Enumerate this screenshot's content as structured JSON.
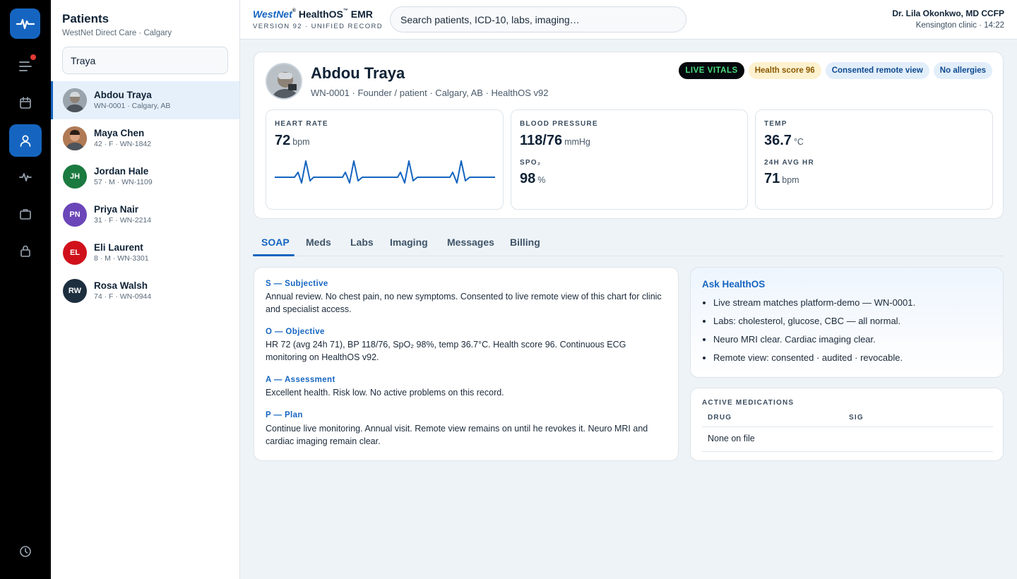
{
  "rail": {
    "items": [
      {
        "icon": "menu-icon",
        "notification": true
      },
      {
        "icon": "calendar-icon"
      },
      {
        "icon": "user-icon",
        "active": true
      },
      {
        "icon": "activity-icon"
      },
      {
        "icon": "briefcase-icon"
      },
      {
        "icon": "lock-icon"
      },
      {
        "icon": "clock-icon"
      }
    ],
    "logo_icon": "pulse-icon",
    "accent": "#1565c0",
    "notification_color": "#e53935"
  },
  "patients": {
    "title": "Patients",
    "subtitle": "WestNet Direct Care · Calgary",
    "search_value": "Traya",
    "list": [
      {
        "name": "Abdou Traya",
        "meta": "WN-0001 · Calgary, AB",
        "initials": "",
        "photo": true,
        "color": "#9aa4ad",
        "selected": true
      },
      {
        "name": "Maya Chen",
        "meta": "42 · F · WN-1842",
        "initials": "",
        "photo": true,
        "color": "#b07a55"
      },
      {
        "name": "Jordan Hale",
        "meta": "57 · M · WN-1109",
        "initials": "JH",
        "color": "#1b7a3f"
      },
      {
        "name": "Priya Nair",
        "meta": "31 · F · WN-2214",
        "initials": "PN",
        "color": "#6b46b8"
      },
      {
        "name": "Eli Laurent",
        "meta": "8 · M · WN-3301",
        "initials": "EL",
        "color": "#d0111b"
      },
      {
        "name": "Rosa Walsh",
        "meta": "74 · F · WN-0944",
        "initials": "RW",
        "color": "#1d2f3f"
      }
    ]
  },
  "header": {
    "brand_west": "WestNet",
    "brand_product": "HealthOS",
    "brand_suffix": "EMR",
    "brand_version": "VERSION 92 · UNIFIED RECORD",
    "search_placeholder": "Search patients, ICD-10, labs, imaging…",
    "doctor": "Dr. Lila Okonkwo, MD CCFP",
    "clinic_time": "Kensington clinic · 14:22"
  },
  "patient": {
    "name": "Abdou Traya",
    "meta": "WN-0001 · Founder / patient · Calgary, AB · HealthOS v92",
    "badges": {
      "live": "LIVE VITALS",
      "score": "Health score 96",
      "consent": "Consented remote view",
      "allergy": "No allergies"
    }
  },
  "vitals": {
    "hr": {
      "label": "HEART RATE",
      "value": "72",
      "unit": "bpm"
    },
    "bp": {
      "label": "BLOOD PRESSURE",
      "value": "118/76",
      "unit": "mmHg"
    },
    "spo2": {
      "label": "SPO₂",
      "value": "98",
      "unit": "%"
    },
    "temp": {
      "label": "TEMP",
      "value": "36.7",
      "unit": "°C"
    },
    "avg_hr": {
      "label": "24H AVG HR",
      "value": "71",
      "unit": "bpm"
    },
    "ecg_color": "#1565c0"
  },
  "tabs": [
    "SOAP",
    "Meds",
    "Labs",
    "Imaging",
    "Messages",
    "Billing"
  ],
  "soap": {
    "s_title": "S — Subjective",
    "s_body": "Annual review. No chest pain, no new symptoms. Consented to live remote view of this chart for clinic and specialist access.",
    "o_title": "O — Objective",
    "o_body": "HR 72 (avg 24h 71), BP 118/76, SpO₂ 98%, temp 36.7°C. Health score 96. Continuous ECG monitoring on HealthOS v92.",
    "a_title": "A — Assessment",
    "a_body": "Excellent health. Risk low. No active problems on this record.",
    "p_title": "P — Plan",
    "p_body": "Continue live monitoring. Annual visit. Remote view remains on until he revokes it. Neuro MRI and cardiac imaging remain clear."
  },
  "ask": {
    "title": "Ask HealthOS",
    "items": [
      "Live stream matches platform-demo — WN-0001.",
      "Labs: cholesterol, glucose, CBC — all normal.",
      "Neuro MRI clear. Cardiac imaging clear.",
      "Remote view: consented · audited · revocable."
    ]
  },
  "meds": {
    "title": "ACTIVE MEDICATIONS",
    "col_drug": "DRUG",
    "col_sig": "SIG",
    "empty": "None on file"
  }
}
